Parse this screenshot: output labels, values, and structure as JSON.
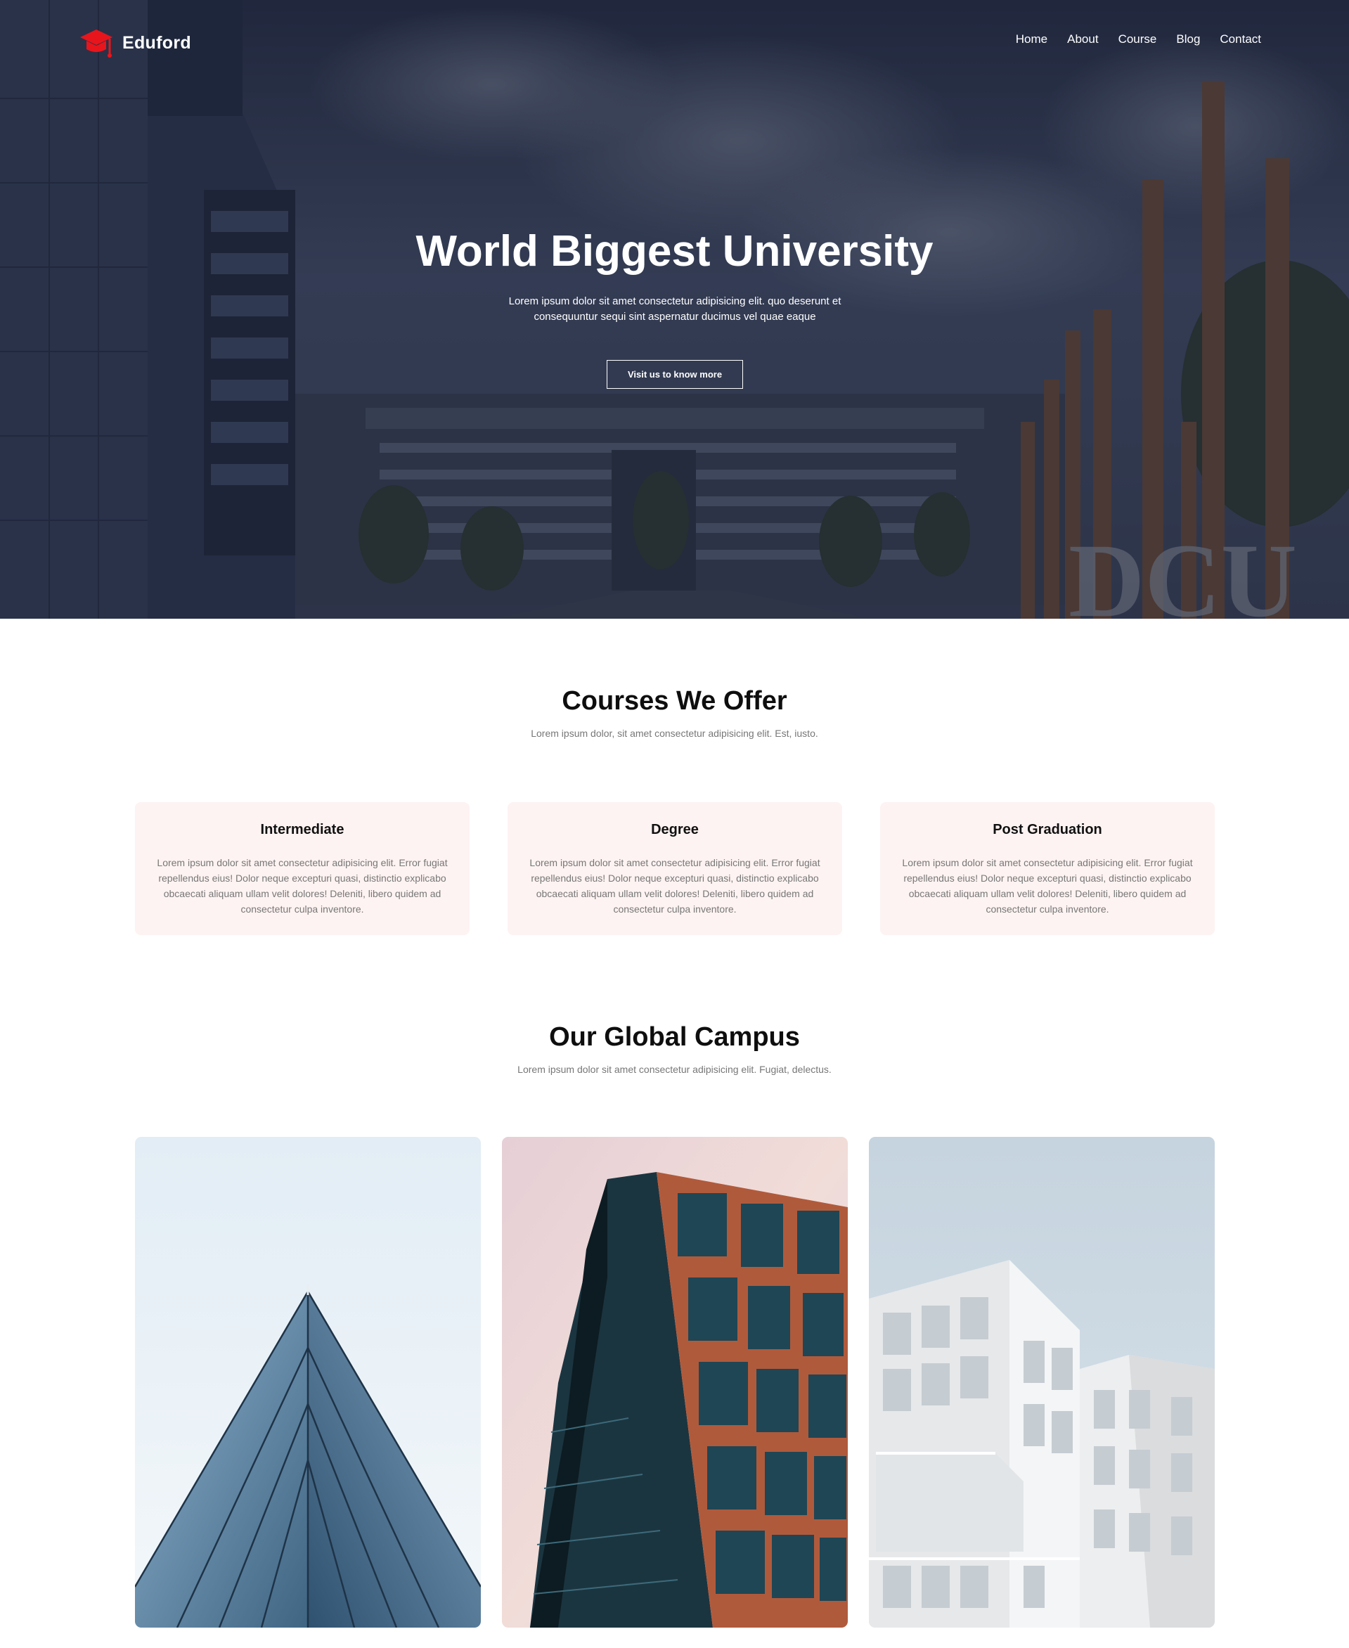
{
  "nav": {
    "brand": "Eduford",
    "links": [
      "Home",
      "About",
      "Course",
      "Blog",
      "Contact"
    ]
  },
  "hero": {
    "title": "World Biggest University",
    "subtitle": "Lorem ipsum dolor sit amet consectetur adipisicing elit. quo deserunt et consequuntur sequi sint aspernatur ducimus vel quae eaque",
    "button": "Visit us to know more",
    "signage": "DCU"
  },
  "courses": {
    "title": "Courses We Offer",
    "subtitle": "Lorem ipsum dolor, sit amet consectetur adipisicing elit. Est, iusto.",
    "items": [
      {
        "name": "Intermediate",
        "text": "Lorem ipsum dolor sit amet consectetur adipisicing elit. Error fugiat repellendus eius! Dolor neque excepturi quasi, distinctio explicabo obcaecati aliquam ullam velit dolores! Deleniti, libero quidem ad consectetur culpa inventore."
      },
      {
        "name": "Degree",
        "text": "Lorem ipsum dolor sit amet consectetur adipisicing elit. Error fugiat repellendus eius! Dolor neque excepturi quasi, distinctio explicabo obcaecati aliquam ullam velit dolores! Deleniti, libero quidem ad consectetur culpa inventore."
      },
      {
        "name": "Post Graduation",
        "text": "Lorem ipsum dolor sit amet consectetur adipisicing elit. Error fugiat repellendus eius! Dolor neque excepturi quasi, distinctio explicabo obcaecati aliquam ullam velit dolores! Deleniti, libero quidem ad consectetur culpa inventore."
      }
    ]
  },
  "campus": {
    "title": "Our Global Campus",
    "subtitle": "Lorem ipsum dolor sit amet consectetur adipisicing elit. Fugiat, delectus."
  },
  "colors": {
    "accent": "#e8151c",
    "card_bg": "#fdf3f2",
    "hero_overlay": "#2c344c"
  },
  "icons": [
    "graduation-cap-icon"
  ]
}
